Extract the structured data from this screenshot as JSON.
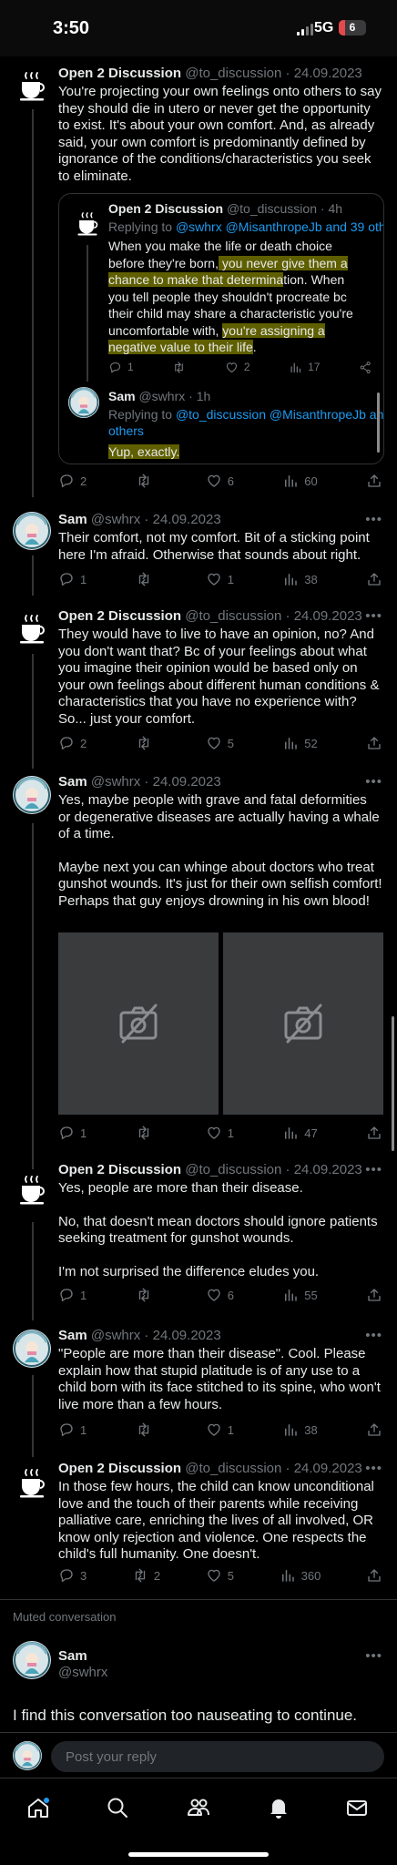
{
  "status_bar": {
    "time": "3:50",
    "network": "5G",
    "battery": "6"
  },
  "tweets": [
    {
      "name": "Open 2 Discussion",
      "handle": "@to_discussion",
      "date": "24.09.2023",
      "paragraphs": [
        "You're projecting your own feelings onto others to say they should die in utero or never get the opportunity to exist. It's about your own comfort. And, as already said, your own comfort is predominantly defined by ignorance of the conditions/characteristics you seek to eliminate."
      ],
      "replies": "2",
      "retweets": "",
      "likes": "6",
      "views": "60"
    },
    {
      "name": "Sam",
      "handle": "@swhrx",
      "date": "24.09.2023",
      "paragraphs": [
        "Their comfort, not my comfort. Bit of a sticking point here I'm afraid. Otherwise that sounds about right."
      ],
      "replies": "1",
      "retweets": "",
      "likes": "1",
      "views": "38"
    },
    {
      "name": "Open 2 Discussion",
      "handle": "@to_discussion",
      "date": "24.09.2023",
      "paragraphs": [
        "They would have to live to have an opinion, no? And you don't want that? Bc of your feelings about what you imagine their opinion would be based only on your own feelings about different human conditions & characteristics that you have no experience with? So... just your comfort."
      ],
      "replies": "2",
      "retweets": "",
      "likes": "5",
      "views": "52"
    },
    {
      "name": "Sam",
      "handle": "@swhrx",
      "date": "24.09.2023",
      "paragraphs": [
        "Yes, maybe people with grave and fatal deformities or degenerative diseases are actually having a whale of a time.",
        "Maybe next you can whinge about doctors who treat gunshot wounds. It's just for their own selfish comfort! Perhaps that guy enjoys drowning in his own blood!"
      ],
      "replies": "1",
      "retweets": "",
      "likes": "1",
      "views": "47"
    },
    {
      "name": "Open 2 Discussion",
      "handle": "@to_discussion",
      "date": "24.09.2023",
      "paragraphs": [
        "Yes, people are more than their disease.",
        "No, that doesn't mean doctors should ignore patients seeking treatment for gunshot wounds.",
        "I'm not surprised the difference eludes you."
      ],
      "replies": "1",
      "retweets": "",
      "likes": "6",
      "views": "55"
    },
    {
      "name": "Sam",
      "handle": "@swhrx",
      "date": "24.09.2023",
      "paragraphs": [
        "\"People are more than their disease\". Cool. Please explain how that stupid platitude is of any use to a child born with its face stitched to its spine, who won't live more than a few hours."
      ],
      "replies": "1",
      "retweets": "",
      "likes": "1",
      "views": "38"
    },
    {
      "name": "Open 2 Discussion",
      "handle": "@to_discussion",
      "date": "24.09.2023",
      "paragraphs": [
        "In those few hours, the child can know unconditional love and the touch of their parents while receiving palliative care, enriching the lives of all involved, OR know only rejection and violence. One respects the child's full humanity. One doesn't."
      ],
      "replies": "3",
      "retweets": "2",
      "likes": "5",
      "views": "360"
    }
  ],
  "quote": {
    "first": {
      "name": "Open 2 Discussion",
      "handle": "@to_discussion",
      "age": "4h",
      "replying_prefix": "Replying to",
      "replying_handles": "@swhrx @MisanthropeJb and 39 oth",
      "lines": [
        "When you make the life or death choice",
        "before they're born, you never give them a",
        "chance to make that determination. When",
        "you tell people they shouldn't procreate bc",
        "their child may share a characteristic you're",
        "uncomfortable with, you're assigning a",
        "negative value to their life."
      ],
      "replies": "1",
      "likes": "2",
      "views": "17"
    },
    "second": {
      "name": "Sam",
      "handle": "@swhrx",
      "age": "1h",
      "replying_prefix": "Replying to",
      "replying_handles": "@to_discussion @MisanthropeJb an",
      "replying_more": "others",
      "text": "Yup, exactly."
    }
  },
  "muted": {
    "label": "Muted conversation",
    "name": "Sam",
    "handle": "@swhrx",
    "text": "I find this conversation too nauseating to continue."
  },
  "reply_bar": {
    "placeholder": "Post your reply"
  },
  "icons": {
    "tabs": [
      "home-icon",
      "search-icon",
      "communities-icon",
      "notifications-icon",
      "messages-icon"
    ],
    "tweet_actions": [
      "reply-icon",
      "retweet-icon",
      "like-icon",
      "views-icon",
      "share-icon"
    ]
  },
  "colors": {
    "background": "#000000",
    "text": "#e7e9ea",
    "secondary": "#71767b",
    "link": "#1d9bf0",
    "highlight": "#bebe00"
  }
}
